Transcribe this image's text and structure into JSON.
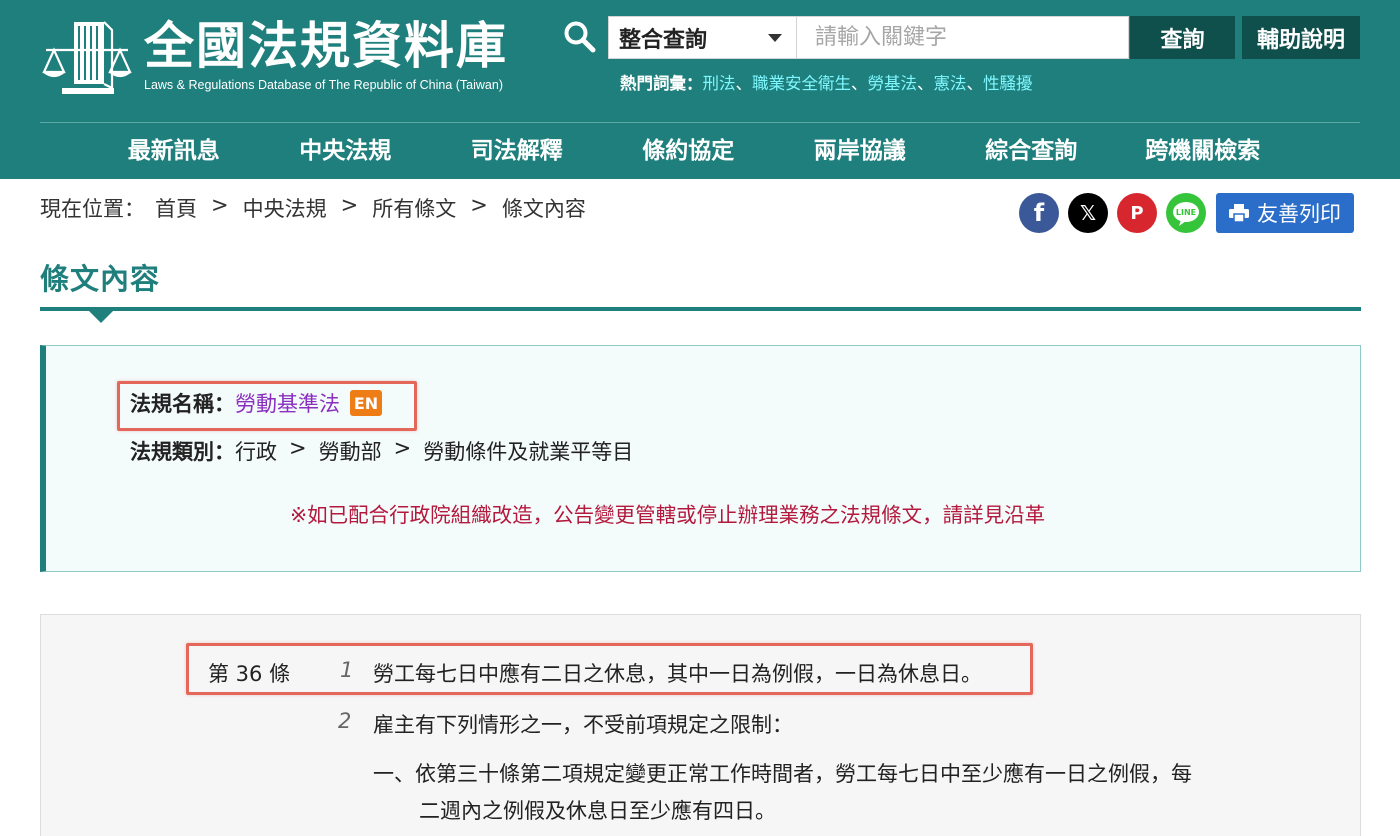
{
  "header": {
    "logo_title": "全國法規資料庫",
    "logo_subtitle": "Laws & Regulations Database of The Republic of China (Taiwan)",
    "search": {
      "selected_scope": "整合查詢",
      "placeholder": "請輸入關鍵字",
      "query_button": "查詢",
      "help_button": "輔助說明"
    },
    "hot_terms": {
      "label": "熱門詞彙：",
      "separator": "、",
      "items": [
        "刑法",
        "職業安全衛生",
        "勞基法",
        "憲法",
        "性騷擾"
      ]
    },
    "nav": [
      "最新訊息",
      "中央法規",
      "司法解釋",
      "條約協定",
      "兩岸協議",
      "綜合查詢",
      "跨機關檢索"
    ]
  },
  "breadcrumb": {
    "label": "現在位置：",
    "separator": ">",
    "items": [
      "首頁",
      "中央法規",
      "所有條文",
      "條文內容"
    ]
  },
  "share": {
    "icons": [
      "facebook-icon",
      "x-icon",
      "plurk-icon",
      "line-icon"
    ],
    "print_label": "友善列印"
  },
  "page_title": "條文內容",
  "law_info": {
    "name_label": "法規名稱：",
    "name": "勞動基準法",
    "en_badge": "EN",
    "category_label": "法規類別：",
    "category_path": [
      "行政",
      "勞動部",
      "勞動條件及就業平等目"
    ],
    "category_separator": ">",
    "notice": "※如已配合行政院組織改造，公告變更管轄或停止辦理業務之法規條文，請詳見沿革"
  },
  "article": {
    "number": "第 36 條",
    "paragraphs": [
      {
        "num": "1",
        "text": "勞工每七日中應有二日之休息，其中一日為例假，一日為休息日。"
      },
      {
        "num": "2",
        "text": "雇主有下列情形之一，不受前項規定之限制："
      }
    ],
    "items": [
      {
        "line1": "一、依第三十條第二項規定變更正常工作時間者，勞工每七日中至少應有一日之例假，每",
        "line2": "二週內之例假及休息日至少應有四日。"
      }
    ]
  },
  "colors": {
    "brand_teal": "#1f7f7c",
    "button_dark": "#0f4f4c",
    "hot_link": "#7ff7ff",
    "law_name": "#8a2fbf",
    "notice_red": "#b3193d",
    "badge_orange": "#ef7d15",
    "highlight": "#e3675a"
  }
}
